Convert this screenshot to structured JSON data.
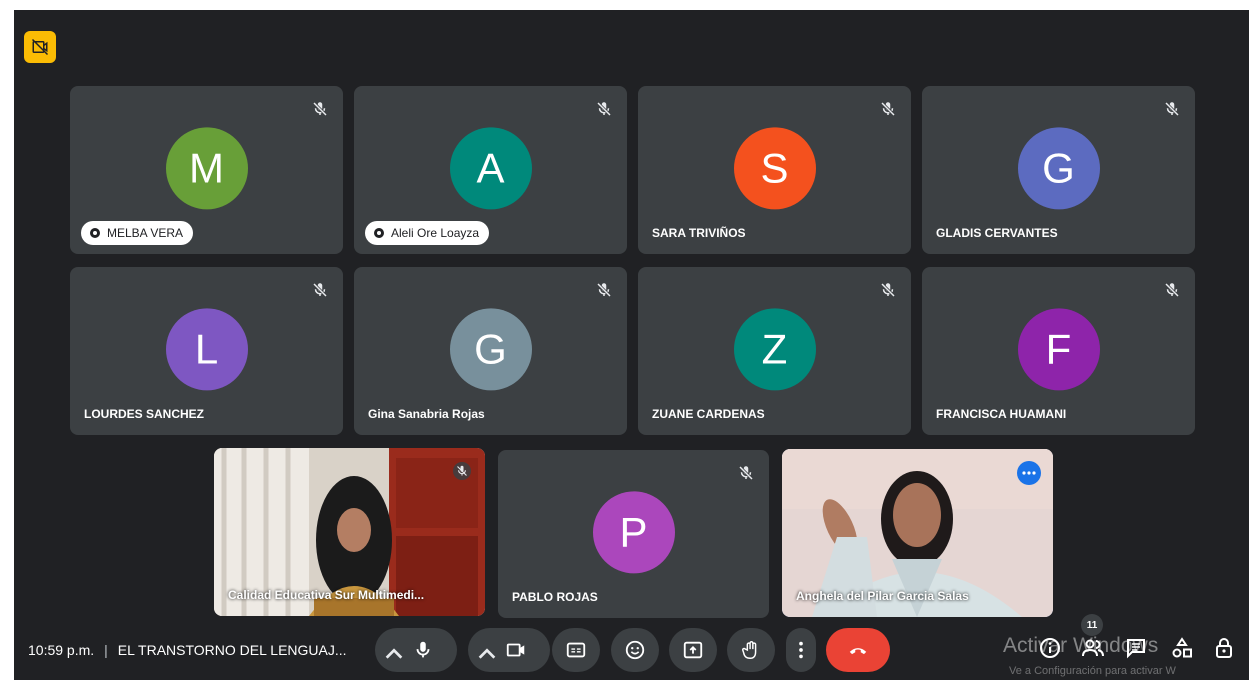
{
  "tiles": [
    {
      "initial": "M",
      "name": "MELBA VERA",
      "color": "#689f38",
      "speaking": true
    },
    {
      "initial": "A",
      "name": "Aleli Ore Loayza",
      "color": "#00897b",
      "speaking": true
    },
    {
      "initial": "S",
      "name": "SARA TRIVIÑOS",
      "color": "#f4511e",
      "speaking": false
    },
    {
      "initial": "G",
      "name": "GLADIS CERVANTES",
      "color": "#5c6bc0",
      "speaking": false
    },
    {
      "initial": "L",
      "name": "LOURDES SANCHEZ",
      "color": "#7e57c2",
      "speaking": false
    },
    {
      "initial": "G",
      "name": "Gina Sanabria Rojas",
      "color": "#78909c",
      "speaking": false
    },
    {
      "initial": "Z",
      "name": "ZUANE CARDENAS",
      "color": "#00897b",
      "speaking": false
    },
    {
      "initial": "F",
      "name": "FRANCISCA HUAMANI",
      "color": "#8e24aa",
      "speaking": false
    }
  ],
  "video_tiles": [
    {
      "name": "Calidad Educativa Sur Multimedi...",
      "muted": true
    },
    {
      "initial": "P",
      "name": "PABLO ROJAS",
      "color": "#ab47bc",
      "muted": true
    },
    {
      "name": "Anghela del Pilar Garcia Salas",
      "muted": false
    }
  ],
  "bottom_bar": {
    "time": "10:59 p.m.",
    "separator": "|",
    "meeting_title": "EL TRANSTORNO DEL LENGUAJ...",
    "participant_count": "11"
  },
  "watermark": {
    "line1": "Activar Windows",
    "line2": "Ve a Configuración para activar W"
  },
  "colors": {
    "background": "#202124",
    "tile": "#3c4043",
    "end_call": "#ea4335",
    "accent": "#1a73e8",
    "badge": "#fbbc04"
  }
}
